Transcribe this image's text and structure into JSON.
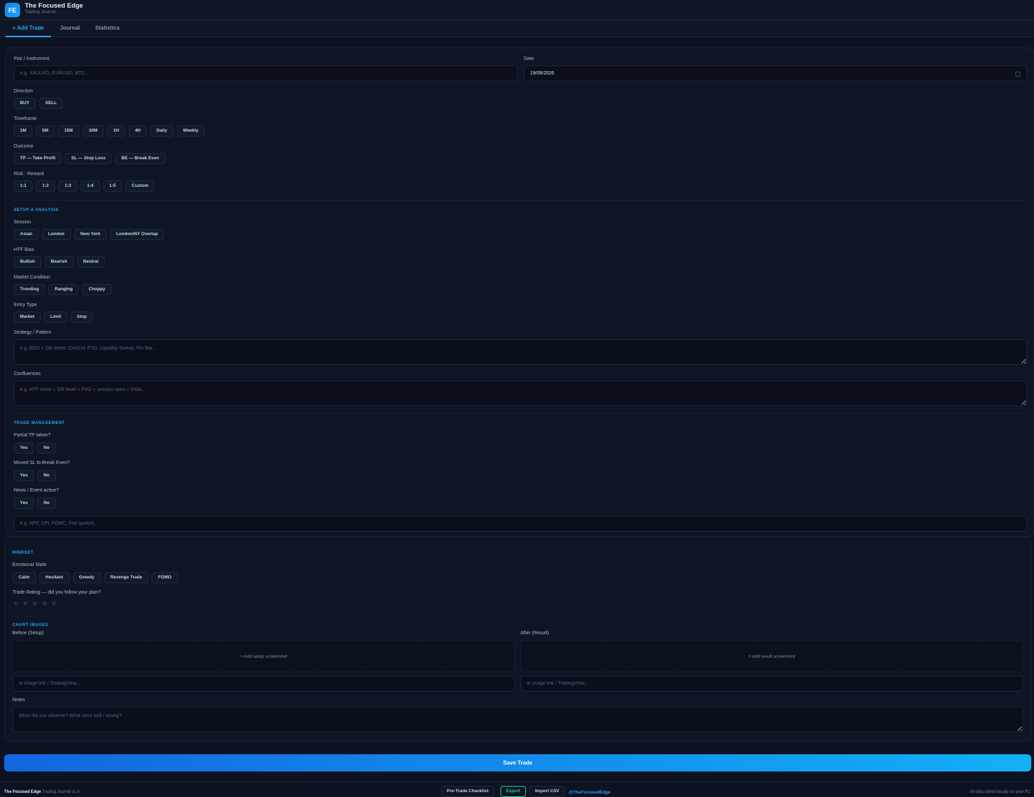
{
  "app": {
    "logo": "FE",
    "title": "The Focused Edge",
    "subtitle": "Trading Journal"
  },
  "tabs": [
    {
      "label": "+ Add Trade",
      "active": true
    },
    {
      "label": "Journal",
      "active": false
    },
    {
      "label": "Statistics",
      "active": false
    }
  ],
  "form": {
    "pair": {
      "label": "Pair / Instrument",
      "placeholder": "e.g. XAUUSD, EURUSD, BTC..."
    },
    "date": {
      "label": "Date",
      "value": "19/06/2026",
      "icon": "calendar-icon"
    },
    "direction": {
      "label": "Direction",
      "options": [
        "BUY",
        "SELL"
      ]
    },
    "timeframe": {
      "label": "Timeframe",
      "options": [
        "1M",
        "5M",
        "15M",
        "30M",
        "1H",
        "4H",
        "Daily",
        "Weekly"
      ]
    },
    "outcome": {
      "label": "Outcome",
      "options": [
        "TP — Take Profit",
        "SL — Stop Loss",
        "BE — Break Even"
      ]
    },
    "risk_reward": {
      "label": "Risk : Reward",
      "options": [
        "1:1",
        "1:2",
        "1:3",
        "1:4",
        "1:5",
        "Custom"
      ]
    }
  },
  "setup": {
    "title": "SETUP & ANALYSIS",
    "session": {
      "label": "Session",
      "options": [
        "Asian",
        "London",
        "New York",
        "London/NY Overlap"
      ]
    },
    "htf_bias": {
      "label": "HTF Bias",
      "options": [
        "Bullish",
        "Bearish",
        "Neutral"
      ]
    },
    "market_condition": {
      "label": "Market Condition",
      "options": [
        "Trending",
        "Ranging",
        "Choppy"
      ]
    },
    "entry_type": {
      "label": "Entry Type",
      "options": [
        "Market",
        "Limit",
        "Stop"
      ]
    },
    "strategy": {
      "label": "Strategy / Pattern",
      "placeholder": "e.g. BOS + OB retest, CHoCH, FVG, Liquidity Sweep, Pin Bar..."
    },
    "confluences": {
      "label": "Confluences",
      "placeholder": "e.g. HTF trend + S/R level + FVG + session open + EMA..."
    }
  },
  "management": {
    "title": "TRADE MANAGEMENT",
    "partial_tp": {
      "label": "Partial TP taken?",
      "options": [
        "Yes",
        "No"
      ]
    },
    "moved_sl": {
      "label": "Moved SL to Break Even?",
      "options": [
        "Yes",
        "No"
      ]
    },
    "news": {
      "label": "News / Event active?",
      "options": [
        "Yes",
        "No"
      ]
    },
    "news_detail": {
      "placeholder": "e.g. NFP, CPI, FOMC, Fed speech..."
    }
  },
  "mindset": {
    "title": "MINDSET",
    "emotional_state": {
      "label": "Emotional State",
      "options": [
        "Calm",
        "Hesitant",
        "Greedy",
        "Revenge Trade",
        "FOMO"
      ]
    },
    "rating": {
      "label": "Trade Rating — did you follow your plan?",
      "stars": [
        "★",
        "★",
        "★",
        "★",
        "★"
      ],
      "value": 0
    }
  },
  "images": {
    "title": "CHART IMAGES",
    "before": {
      "label": "Before (Setup)",
      "drop_text": "+ Add setup screenshot",
      "link_placeholder": "or image link / TradingView..."
    },
    "after": {
      "label": "After (Result)",
      "drop_text": "+ Add result screenshot",
      "link_placeholder": "or image link / TradingView..."
    }
  },
  "notes": {
    "label": "Notes",
    "placeholder": "What did you observe? What went well / wrong?"
  },
  "save_label": "Save Trade",
  "footer": {
    "brand": "The Focused Edge",
    "version": "Trading Journal v1.0",
    "checklist": "Pre-Trade Checklist",
    "export": "Export",
    "import": "Import CSV",
    "handle": "@TheFocusedEdge",
    "note": "All data stored locally on your PC"
  },
  "colors": {
    "accent": "#2aa6f0",
    "background": "#0c1220",
    "export": "#1fcf8e"
  }
}
